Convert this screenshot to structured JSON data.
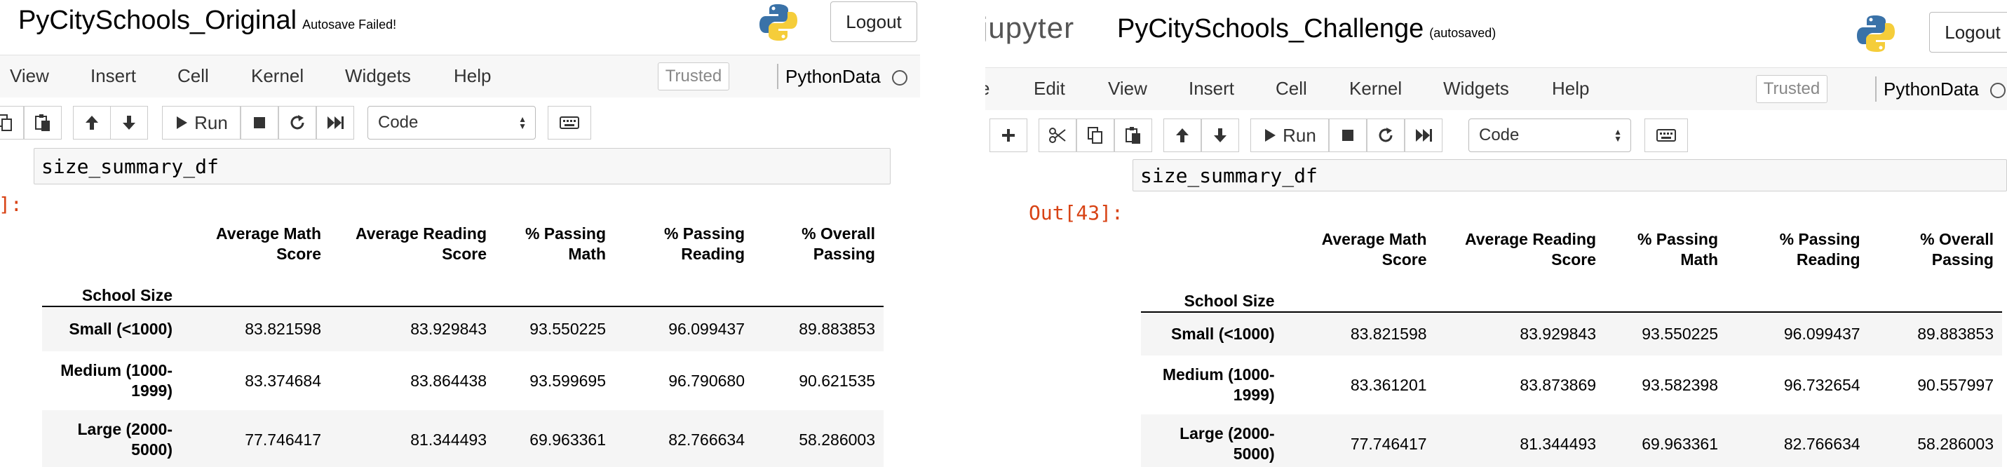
{
  "left": {
    "notebook_name": "PyCitySchools_Original",
    "save_status": "Autosave Failed!",
    "logout_label": "Logout",
    "menu": [
      "View",
      "Insert",
      "Cell",
      "Kernel",
      "Widgets",
      "Help"
    ],
    "trusted_label": "Trusted",
    "kernel_name": "PythonData",
    "run_label": "Run",
    "cell_type": "Code",
    "code": "size_summary_df",
    "out_prompt": "]:",
    "columns": [
      [
        "Average Math",
        "Score"
      ],
      [
        "Average Reading",
        "Score"
      ],
      [
        "% Passing",
        "Math"
      ],
      [
        "% Passing",
        "Reading"
      ],
      [
        "% Overall",
        "Passing"
      ]
    ],
    "index_name": "School Size",
    "rows": [
      {
        "label": [
          "Small (<1000)"
        ],
        "values": [
          "83.821598",
          "83.929843",
          "93.550225",
          "96.099437",
          "89.883853"
        ]
      },
      {
        "label": [
          "Medium (1000-",
          "1999)"
        ],
        "values": [
          "83.374684",
          "83.864438",
          "93.599695",
          "96.790680",
          "90.621535"
        ]
      },
      {
        "label": [
          "Large (2000-",
          "5000)"
        ],
        "values": [
          "77.746417",
          "81.344493",
          "69.963361",
          "82.766634",
          "58.286003"
        ]
      }
    ]
  },
  "right": {
    "app_name": "jupyter",
    "notebook_name": "PyCitySchools_Challenge",
    "save_status": "(autosaved)",
    "logout_label": "Logout",
    "menu": [
      "e",
      "Edit",
      "View",
      "Insert",
      "Cell",
      "Kernel",
      "Widgets",
      "Help"
    ],
    "trusted_label": "Trusted",
    "kernel_name": "PythonData",
    "run_label": "Run",
    "cell_type": "Code",
    "code": "size_summary_df",
    "out_prompt": "Out[43]:",
    "columns": [
      [
        "Average Math",
        "Score"
      ],
      [
        "Average Reading",
        "Score"
      ],
      [
        "% Passing",
        "Math"
      ],
      [
        "% Passing",
        "Reading"
      ],
      [
        "% Overall",
        "Passing"
      ]
    ],
    "index_name": "School Size",
    "rows": [
      {
        "label": [
          "Small (<1000)"
        ],
        "values": [
          "83.821598",
          "83.929843",
          "93.550225",
          "96.099437",
          "89.883853"
        ]
      },
      {
        "label": [
          "Medium (1000-",
          "1999)"
        ],
        "values": [
          "83.361201",
          "83.873869",
          "93.582398",
          "96.732654",
          "90.557997"
        ]
      },
      {
        "label": [
          "Large (2000-",
          "5000)"
        ],
        "values": [
          "77.746417",
          "81.344493",
          "69.963361",
          "82.766634",
          "58.286003"
        ]
      }
    ]
  }
}
